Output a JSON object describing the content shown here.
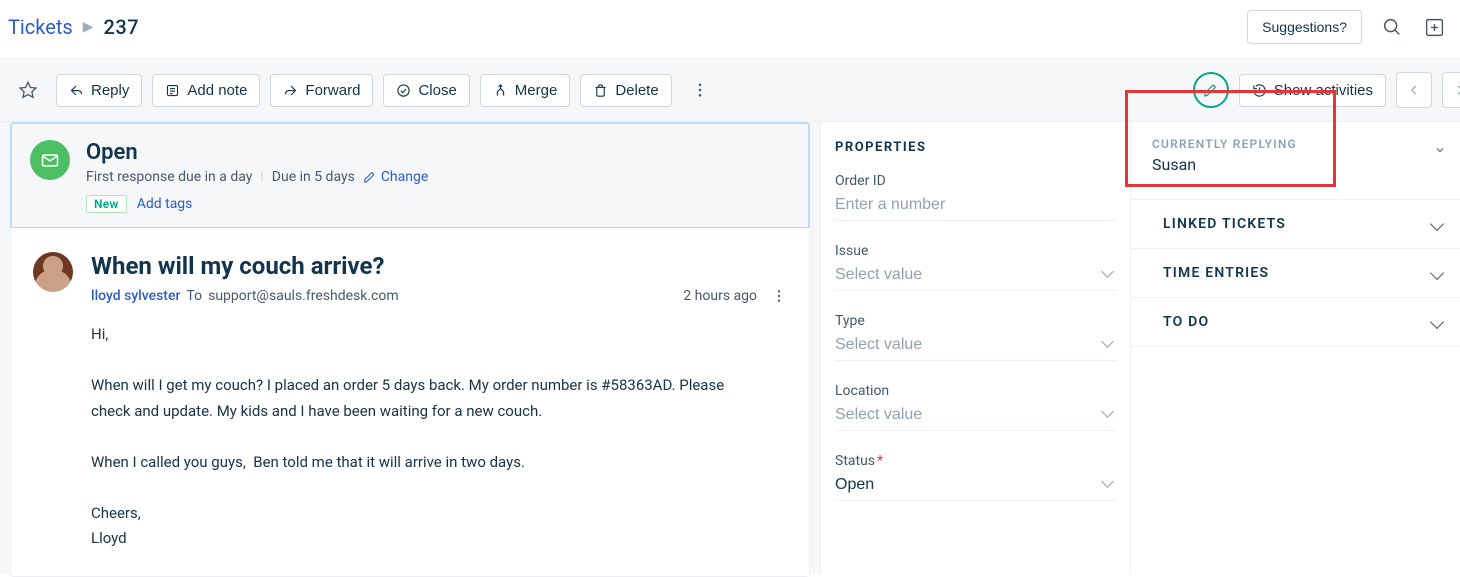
{
  "breadcrumb": {
    "root": "Tickets",
    "id": "237"
  },
  "topbar": {
    "suggestions": "Suggestions?"
  },
  "toolbar": {
    "reply": "Reply",
    "add_note": "Add note",
    "forward": "Forward",
    "close": "Close",
    "merge": "Merge",
    "delete": "Delete",
    "show_activities": "Show activities"
  },
  "status_card": {
    "title": "Open",
    "first_resp": "First response due in a day",
    "due": "Due in 5 days",
    "change": "Change",
    "new_tag": "New",
    "add_tags": "Add tags"
  },
  "ticket": {
    "subject": "When will my couch arrive?",
    "from_name": "lloyd sylvester",
    "to_label": "To",
    "to_addr": "support@sauls.freshdesk.com",
    "time": "2 hours ago",
    "body": "Hi,\n\nWhen will I get my couch? I placed an order 5 days back. My order number is #58363AD. Please check and update. My kids and I have been waiting for a new couch.\n\nWhen I called you guys,  Ben told me that it will arrive in two days.\n\nCheers,\nLloyd"
  },
  "properties": {
    "heading": "PROPERTIES",
    "order_id": {
      "label": "Order ID",
      "placeholder": "Enter a number"
    },
    "issue": {
      "label": "Issue",
      "placeholder": "Select value"
    },
    "type": {
      "label": "Type",
      "placeholder": "Select value"
    },
    "location": {
      "label": "Location",
      "placeholder": "Select value"
    },
    "status": {
      "label": "Status",
      "value": "Open"
    }
  },
  "side": {
    "currently_replying_label": "CURRENTLY REPLYING",
    "currently_replying_name": "Susan",
    "linked": "LINKED TICKETS",
    "time_entries": "TIME ENTRIES",
    "todo": "TO DO"
  }
}
